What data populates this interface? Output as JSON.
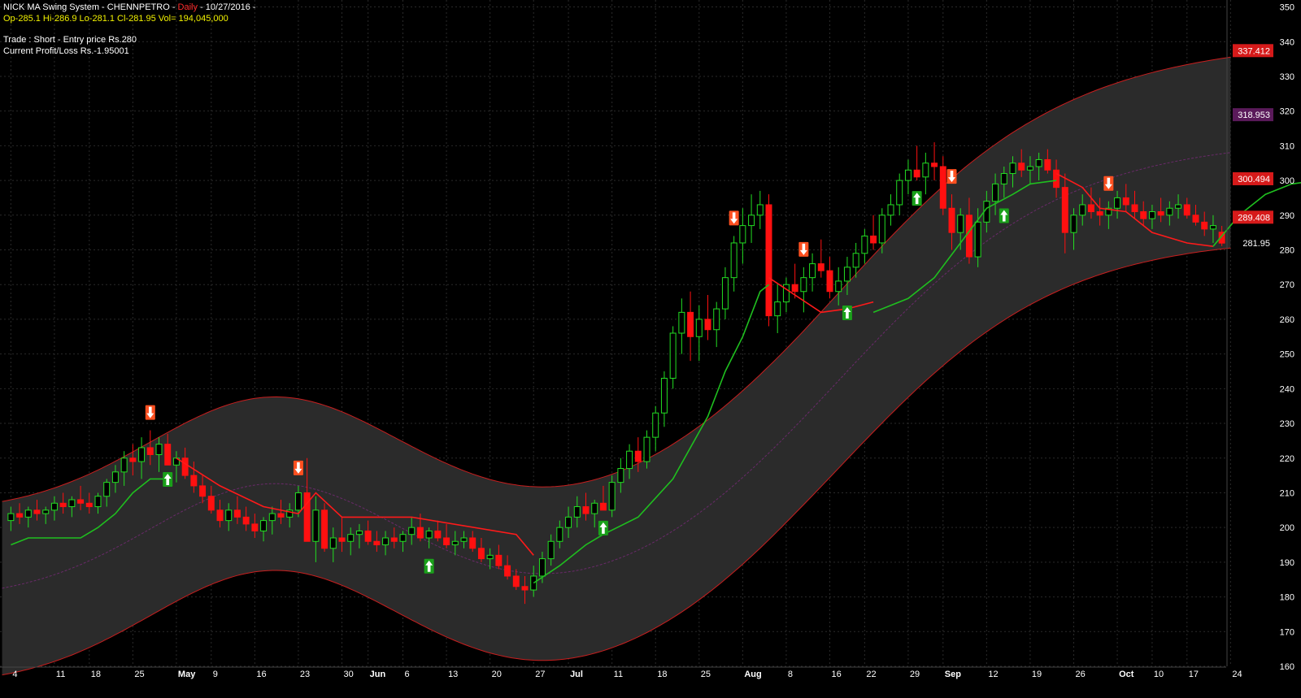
{
  "header": {
    "system_name": "NICK MA Swing System - CHENNPETRO -",
    "interval": "Daily",
    "date": "- 10/27/2016 -",
    "ohlc_line": "Op-285.1  Hi-286.9  Lo-281.1  Cl-281.95  Vol= 194,045,000",
    "trade_line": "Trade : Short - Entry price Rs.280",
    "pnl_line": "Current Profit/Loss Rs.-1.95001"
  },
  "colors": {
    "background": "#000000",
    "grid": "#2a2a2a",
    "band_fill": "#2b2b2b",
    "band_edge": "#c81e1e",
    "band_mid": "#6a2a6a",
    "bull": "#22dd22",
    "bear": "#ff1010",
    "stop_long": "#1fbf1f",
    "stop_short": "#ff1a1a",
    "axis_text": "#ffffff"
  },
  "chart_data": {
    "type": "candlestick",
    "title": "NICK MA Swing System - CHENNPETRO - Daily - 10/27/2016 -",
    "symbol": "CHENNPETRO",
    "ylim": [
      160,
      352
    ],
    "y_ticks": [
      160,
      170,
      180,
      190,
      200,
      210,
      220,
      230,
      240,
      250,
      260,
      270,
      280,
      290,
      300,
      310,
      320,
      330,
      340,
      350
    ],
    "x_labels": [
      "4",
      "11",
      "18",
      "25",
      "May",
      "9",
      "16",
      "23",
      "30",
      "Jun",
      "6",
      "13",
      "20",
      "27",
      "Jul",
      "11",
      "18",
      "25",
      "Aug",
      "8",
      "16",
      "22",
      "29",
      "Sep",
      "12",
      "19",
      "26",
      "Oct",
      "10",
      "17",
      "24"
    ],
    "x_label_index": [
      0,
      5,
      9,
      14,
      19,
      23,
      28,
      33,
      38,
      41,
      45,
      50,
      55,
      60,
      64,
      69,
      74,
      79,
      84,
      89,
      94,
      98,
      103,
      107,
      112,
      117,
      122,
      127,
      131,
      135,
      140
    ],
    "candles": [
      [
        202,
        206,
        199,
        204
      ],
      [
        204,
        207,
        201,
        203
      ],
      [
        203,
        206,
        200,
        205
      ],
      [
        205,
        208,
        202,
        204
      ],
      [
        204,
        206,
        201,
        205
      ],
      [
        205,
        209,
        202,
        207
      ],
      [
        207,
        210,
        204,
        206
      ],
      [
        206,
        209,
        203,
        208
      ],
      [
        208,
        212,
        205,
        207
      ],
      [
        207,
        210,
        204,
        206
      ],
      [
        206,
        210,
        204,
        209
      ],
      [
        209,
        214,
        206,
        213
      ],
      [
        213,
        218,
        210,
        216
      ],
      [
        216,
        222,
        212,
        220
      ],
      [
        220,
        224,
        215,
        219
      ],
      [
        219,
        226,
        214,
        223
      ],
      [
        223,
        228,
        218,
        221
      ],
      [
        221,
        226,
        216,
        224
      ],
      [
        224,
        227,
        219,
        218
      ],
      [
        218,
        222,
        213,
        220
      ],
      [
        220,
        223,
        214,
        215
      ],
      [
        215,
        219,
        210,
        212
      ],
      [
        212,
        215,
        207,
        209
      ],
      [
        209,
        212,
        204,
        205
      ],
      [
        205,
        208,
        200,
        202
      ],
      [
        202,
        207,
        199,
        205
      ],
      [
        205,
        209,
        201,
        203
      ],
      [
        203,
        206,
        199,
        201
      ],
      [
        201,
        204,
        197,
        199
      ],
      [
        199,
        203,
        196,
        202
      ],
      [
        202,
        206,
        198,
        204
      ],
      [
        204,
        208,
        201,
        203
      ],
      [
        203,
        207,
        200,
        205
      ],
      [
        205,
        212,
        203,
        210
      ],
      [
        210,
        220,
        196,
        196
      ],
      [
        196,
        209,
        190,
        205
      ],
      [
        205,
        207,
        193,
        194
      ],
      [
        194,
        200,
        190,
        197
      ],
      [
        197,
        203,
        193,
        196
      ],
      [
        196,
        200,
        192,
        198
      ],
      [
        198,
        201,
        194,
        199
      ],
      [
        199,
        202,
        195,
        196
      ],
      [
        196,
        199,
        193,
        195
      ],
      [
        195,
        199,
        192,
        197
      ],
      [
        197,
        200,
        194,
        196
      ],
      [
        196,
        199,
        193,
        198
      ],
      [
        198,
        203,
        195,
        200
      ],
      [
        200,
        204,
        196,
        197
      ],
      [
        197,
        200,
        194,
        199
      ],
      [
        199,
        202,
        196,
        197
      ],
      [
        197,
        201,
        194,
        195
      ],
      [
        195,
        199,
        192,
        196
      ],
      [
        196,
        199,
        194,
        197
      ],
      [
        197,
        199,
        193,
        194
      ],
      [
        194,
        197,
        190,
        191
      ],
      [
        191,
        194,
        188,
        192
      ],
      [
        192,
        195,
        188,
        189
      ],
      [
        189,
        192,
        185,
        186
      ],
      [
        186,
        188,
        182,
        183
      ],
      [
        183,
        186,
        178,
        182
      ],
      [
        182,
        189,
        180,
        186
      ],
      [
        186,
        193,
        184,
        191
      ],
      [
        191,
        198,
        189,
        196
      ],
      [
        196,
        202,
        194,
        200
      ],
      [
        200,
        206,
        197,
        203
      ],
      [
        203,
        209,
        200,
        206
      ],
      [
        206,
        210,
        202,
        204
      ],
      [
        204,
        208,
        200,
        207
      ],
      [
        207,
        212,
        205,
        205
      ],
      [
        205,
        215,
        203,
        213
      ],
      [
        213,
        220,
        210,
        217
      ],
      [
        217,
        224,
        214,
        222
      ],
      [
        222,
        226,
        216,
        219
      ],
      [
        219,
        228,
        217,
        226
      ],
      [
        226,
        235,
        222,
        233
      ],
      [
        233,
        245,
        229,
        243
      ],
      [
        243,
        258,
        240,
        256
      ],
      [
        256,
        266,
        250,
        262
      ],
      [
        262,
        268,
        248,
        255
      ],
      [
        255,
        264,
        248,
        260
      ],
      [
        260,
        267,
        254,
        257
      ],
      [
        257,
        265,
        252,
        263
      ],
      [
        263,
        275,
        260,
        272
      ],
      [
        272,
        284,
        268,
        282
      ],
      [
        282,
        292,
        276,
        287
      ],
      [
        287,
        296,
        282,
        290
      ],
      [
        290,
        297,
        286,
        293
      ],
      [
        293,
        296,
        258,
        261
      ],
      [
        261,
        270,
        256,
        265
      ],
      [
        265,
        272,
        262,
        270
      ],
      [
        270,
        276,
        266,
        268
      ],
      [
        268,
        275,
        262,
        272
      ],
      [
        272,
        279,
        268,
        276
      ],
      [
        276,
        283,
        272,
        274
      ],
      [
        274,
        278,
        266,
        268
      ],
      [
        268,
        275,
        264,
        271
      ],
      [
        271,
        278,
        267,
        275
      ],
      [
        275,
        282,
        272,
        279
      ],
      [
        279,
        286,
        276,
        284
      ],
      [
        284,
        290,
        280,
        282
      ],
      [
        282,
        292,
        279,
        290
      ],
      [
        290,
        296,
        287,
        293
      ],
      [
        293,
        302,
        290,
        300
      ],
      [
        300,
        306,
        296,
        303
      ],
      [
        303,
        310,
        300,
        301
      ],
      [
        301,
        308,
        296,
        305
      ],
      [
        305,
        311,
        300,
        304
      ],
      [
        304,
        307,
        290,
        292
      ],
      [
        292,
        296,
        280,
        285
      ],
      [
        285,
        292,
        280,
        290
      ],
      [
        290,
        295,
        276,
        278
      ],
      [
        278,
        292,
        275,
        288
      ],
      [
        288,
        297,
        285,
        294
      ],
      [
        294,
        302,
        290,
        299
      ],
      [
        299,
        304,
        295,
        302
      ],
      [
        302,
        307,
        298,
        305
      ],
      [
        305,
        309,
        301,
        303
      ],
      [
        303,
        307,
        299,
        304
      ],
      [
        304,
        308,
        300,
        306
      ],
      [
        306,
        309,
        302,
        303
      ],
      [
        303,
        306,
        295,
        298
      ],
      [
        298,
        302,
        279,
        285
      ],
      [
        285,
        292,
        280,
        290
      ],
      [
        290,
        296,
        287,
        293
      ],
      [
        293,
        298,
        289,
        291
      ],
      [
        291,
        295,
        287,
        290
      ],
      [
        290,
        294,
        286,
        292
      ],
      [
        292,
        297,
        289,
        295
      ],
      [
        295,
        299,
        291,
        293
      ],
      [
        293,
        297,
        289,
        291
      ],
      [
        291,
        294,
        287,
        289
      ],
      [
        289,
        293,
        286,
        291
      ],
      [
        291,
        295,
        288,
        290
      ],
      [
        290,
        294,
        287,
        292
      ],
      [
        292,
        296,
        289,
        293
      ],
      [
        293,
        295,
        289,
        290
      ],
      [
        290,
        293,
        287,
        288
      ],
      [
        288,
        291,
        284,
        286
      ],
      [
        286,
        290,
        282,
        287
      ],
      [
        285.1,
        286.9,
        281.1,
        281.95
      ]
    ],
    "trailing_stop": [
      [
        [
          0,
          195
        ],
        [
          2,
          197
        ],
        [
          8,
          197
        ],
        [
          10,
          200
        ],
        [
          12,
          204
        ],
        [
          14,
          210
        ],
        [
          16,
          214
        ],
        [
          18,
          214
        ]
      ],
      [
        [
          19,
          220
        ],
        [
          24,
          212
        ],
        [
          29,
          206
        ],
        [
          33,
          204
        ],
        [
          35,
          210
        ],
        [
          38,
          203
        ],
        [
          46,
          203
        ],
        [
          58,
          198
        ],
        [
          60,
          192
        ]
      ],
      [
        [
          60,
          184
        ],
        [
          63,
          189
        ],
        [
          66,
          195
        ],
        [
          68,
          198
        ],
        [
          72,
          203
        ],
        [
          76,
          214
        ],
        [
          80,
          232
        ],
        [
          82,
          245
        ],
        [
          84,
          255
        ],
        [
          86,
          268
        ],
        [
          87,
          270
        ]
      ],
      [
        [
          87,
          272
        ],
        [
          93,
          262
        ],
        [
          96,
          263
        ],
        [
          99,
          265
        ]
      ],
      [
        [
          99,
          262
        ],
        [
          103,
          266
        ],
        [
          106,
          272
        ],
        [
          109,
          282
        ],
        [
          112,
          292
        ],
        [
          115,
          296
        ],
        [
          117,
          299
        ],
        [
          120,
          300
        ]
      ],
      [
        [
          120,
          302
        ],
        [
          123,
          298
        ],
        [
          125,
          292
        ],
        [
          128,
          291
        ],
        [
          131,
          285
        ],
        [
          135,
          282
        ],
        [
          138,
          281
        ]
      ],
      [
        [
          138,
          281
        ],
        [
          141,
          290
        ],
        [
          144,
          296
        ],
        [
          147,
          299
        ],
        [
          150,
          300
        ],
        [
          152,
          300
        ]
      ],
      [
        [
          152,
          302
        ],
        [
          154,
          290
        ],
        [
          156,
          286
        ],
        [
          158,
          284
        ],
        [
          160,
          285
        ]
      ]
    ],
    "buy_signals": [
      18,
      48,
      68,
      96,
      104,
      114
    ],
    "sell_signals": [
      16,
      33,
      83,
      91,
      108,
      126
    ],
    "price_labels": [
      {
        "text": "337.412",
        "value": 337.412,
        "color": "#d61a1a"
      },
      {
        "text": "318.953",
        "value": 318.953,
        "color": "#5a1a5a"
      },
      {
        "text": "300.494",
        "value": 300.494,
        "color": "#d61a1a"
      },
      {
        "text": "289.408",
        "value": 289.408,
        "color": "#d61a1a"
      },
      {
        "text": "281.95",
        "value": 281.95,
        "color": "#000000"
      }
    ]
  }
}
